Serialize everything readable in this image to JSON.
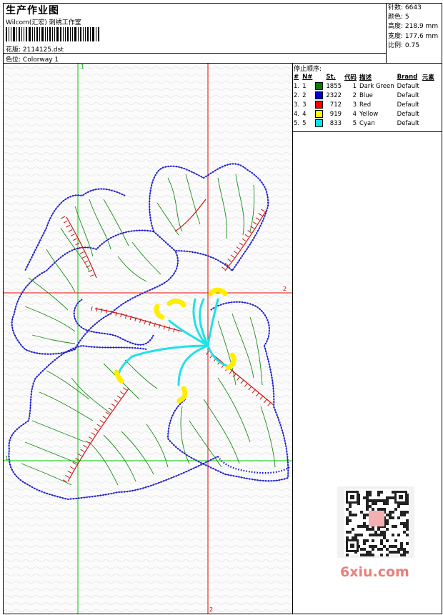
{
  "header": {
    "title": "生产作业图",
    "company": "Wilcom(汇宏) 刺绣工作室",
    "design_label": "花版:",
    "design_value": "2114125.dst",
    "colorway_label": "色位:",
    "colorway_value": "Colorway 1"
  },
  "specs": [
    {
      "label": "针数:",
      "value": "6643"
    },
    {
      "label": "颜色:",
      "value": "5"
    },
    {
      "label": "高度:",
      "value": "218.9 mm"
    },
    {
      "label": "宽度:",
      "value": "177.6 mm"
    },
    {
      "label": "比例:",
      "value": "0.75"
    }
  ],
  "stop_sequence": {
    "title": "停止顺序:",
    "columns": [
      "#",
      "N#",
      "St.",
      "代码",
      "描述",
      "Brand",
      "元素"
    ],
    "rows": [
      {
        "idx": "1.",
        "n": "1",
        "color": "#008000",
        "stitches": "1855",
        "code": "1",
        "desc": "Dark Green",
        "brand": "Default"
      },
      {
        "idx": "2.",
        "n": "2",
        "color": "#0000cc",
        "stitches": "2322",
        "code": "2",
        "desc": "Blue",
        "brand": "Default"
      },
      {
        "idx": "3.",
        "n": "3",
        "color": "#ff0000",
        "stitches": "712",
        "code": "3",
        "desc": "Red",
        "brand": "Default"
      },
      {
        "idx": "4.",
        "n": "4",
        "color": "#ffff00",
        "stitches": "919",
        "code": "4",
        "desc": "Yellow",
        "brand": "Default"
      },
      {
        "idx": "5.",
        "n": "5",
        "color": "#00e5e5",
        "stitches": "833",
        "code": "5",
        "desc": "Cyan",
        "brand": "Default"
      }
    ]
  },
  "canvas": {
    "axis_labels": {
      "green_top": "1",
      "green_left": "1",
      "red_right": "2",
      "red_bottom": "2"
    }
  },
  "watermark": "6xiu.com"
}
